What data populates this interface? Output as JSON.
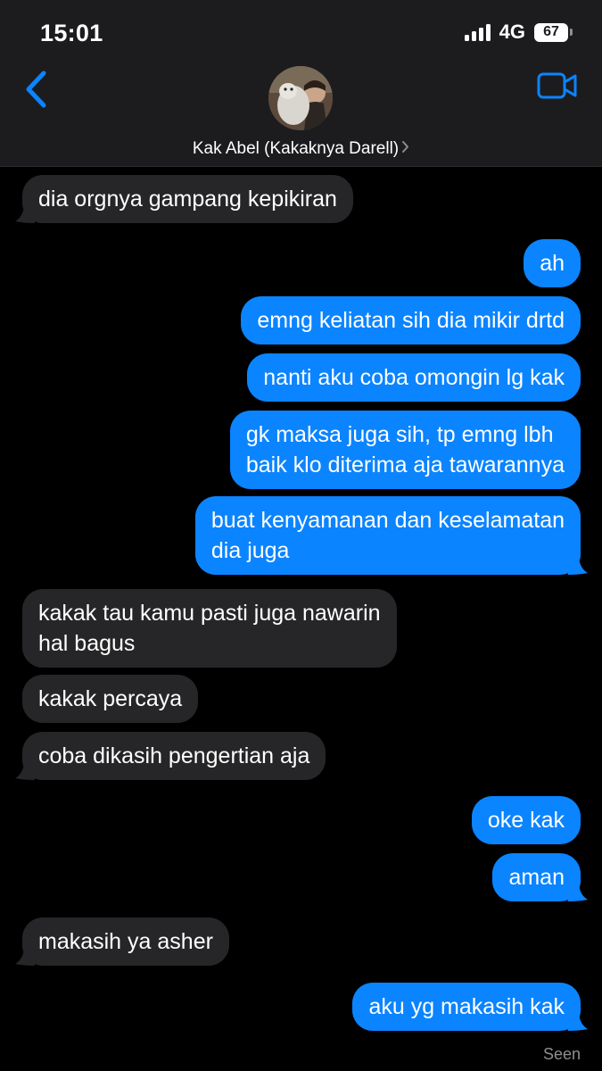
{
  "status_bar": {
    "time": "15:01",
    "network": "4G",
    "battery": "67"
  },
  "header": {
    "contact_name": "Kak Abel (Kakaknya Darell)",
    "back_icon": "chevron-left-icon",
    "video_icon": "video-camera-icon"
  },
  "colors": {
    "incoming_bubble": "#262628",
    "outgoing_bubble": "#0b84ff",
    "accent": "#0b84ff",
    "header_bg": "#1c1c1e"
  },
  "messages": [
    {
      "direction": "in",
      "text": "dia orgnya gampang kepikiran"
    },
    {
      "direction": "out",
      "text": "ah"
    },
    {
      "direction": "out",
      "text": "emng keliatan sih dia mikir drtd"
    },
    {
      "direction": "out",
      "text": "nanti aku coba omongin lg kak"
    },
    {
      "direction": "out",
      "line1": "gk maksa juga sih, tp emng lbh",
      "line2": "baik klo diterima aja tawarannya"
    },
    {
      "direction": "out",
      "line1": "buat kenyamanan dan keselamatan",
      "line2": "dia juga"
    },
    {
      "direction": "in",
      "line1": "kakak tau kamu pasti juga nawarin",
      "line2": "hal bagus"
    },
    {
      "direction": "in",
      "text": "kakak percaya"
    },
    {
      "direction": "in",
      "text": "coba dikasih pengertian aja"
    },
    {
      "direction": "out",
      "text": "oke kak"
    },
    {
      "direction": "out",
      "text": "aman"
    },
    {
      "direction": "in",
      "text": "makasih ya asher"
    },
    {
      "direction": "out",
      "text": "aku yg makasih kak"
    }
  ],
  "read_receipt": "Seen"
}
